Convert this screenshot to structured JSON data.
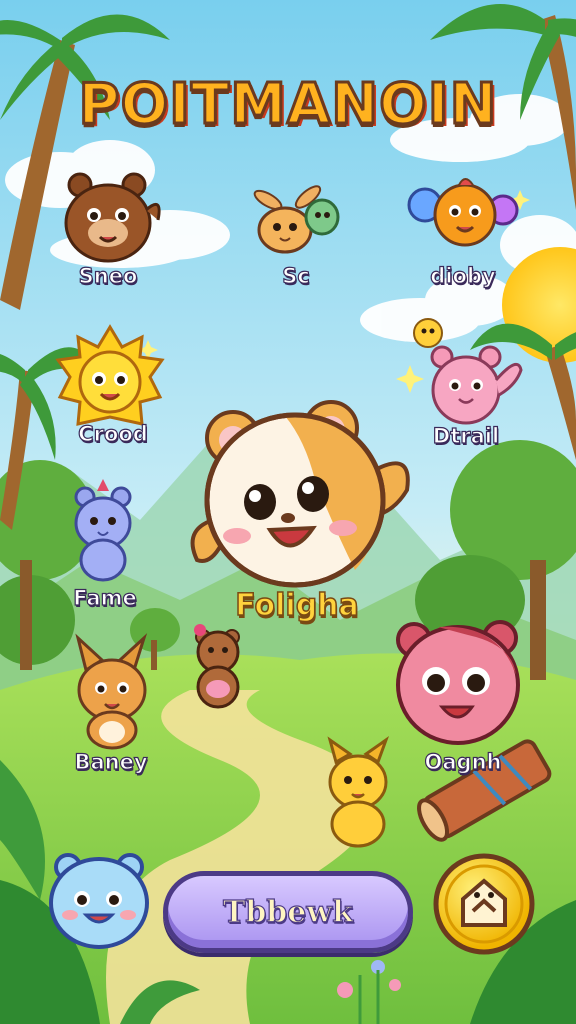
{
  "game": {
    "title": "POITMANOIN",
    "featured": {
      "name": "Foligha"
    },
    "characters": [
      {
        "id": "bear",
        "name": "Sneo"
      },
      {
        "id": "bunny-duo",
        "name": "Sc"
      },
      {
        "id": "orb-bird",
        "name": "dioby"
      },
      {
        "id": "sun-cat",
        "name": "Crood"
      },
      {
        "id": "pink-bear",
        "name": "Dtrail"
      },
      {
        "id": "blue-bear",
        "name": "Fame"
      },
      {
        "id": "fox",
        "name": "Baney"
      },
      {
        "id": "red-bear",
        "name": "Oagnh"
      },
      {
        "id": "little-bear",
        "name": ""
      },
      {
        "id": "yellow-chick",
        "name": ""
      }
    ],
    "play_button": {
      "label": "Tbbewk"
    }
  },
  "colors": {
    "sky_top": "#7fd3ef",
    "grass": "#8ad24e",
    "title_fill": "#ffb21f",
    "button": "#b6a2f5"
  }
}
